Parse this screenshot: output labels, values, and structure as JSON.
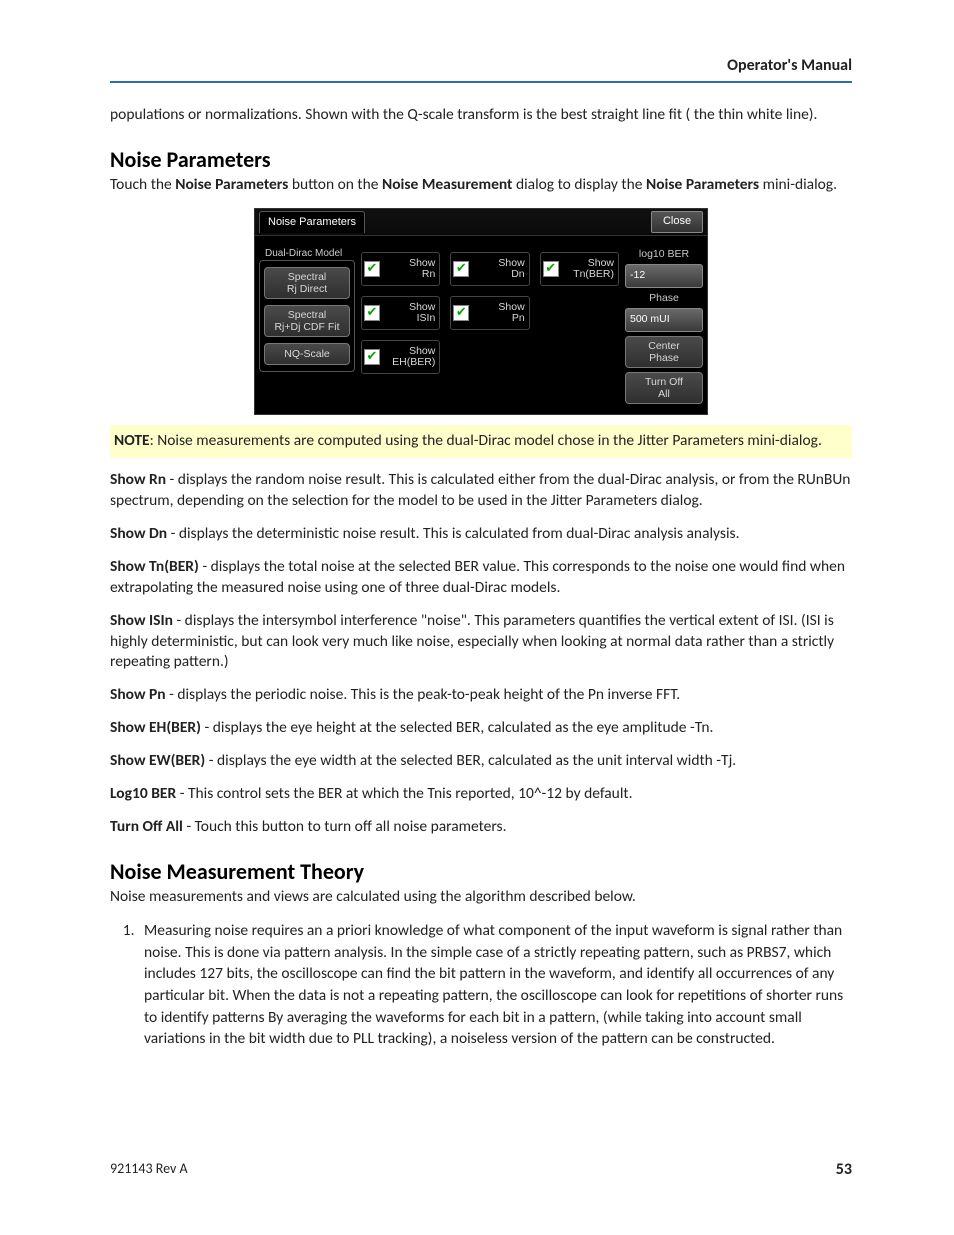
{
  "header": {
    "title": "Operator's Manual"
  },
  "intro": "populations or normalizations. Shown with the Q-scale transform is the best straight line fit ( the thin white line).",
  "section1": {
    "heading": "Noise Parameters",
    "lead_a": "Touch the ",
    "lead_b": "Noise Parameters",
    "lead_c": " button on the ",
    "lead_d": "Noise Measurement",
    "lead_e": " dialog to display the ",
    "lead_f": "Noise Parameters",
    "lead_g": " mini-dialog."
  },
  "dialog": {
    "tab": "Noise Parameters",
    "close": "Close",
    "groupLabel": "Dual-Dirac Model",
    "leftButtons": [
      "Spectral\nRj Direct",
      "Spectral\nRj+Dj CDF Fit",
      "NQ-Scale"
    ],
    "checks": {
      "rn": "Show\nRn",
      "dn": "Show\nDn",
      "tn": "Show\nTn(BER)",
      "isin": "Show\nISIn",
      "pn": "Show\nPn",
      "eh": "Show\nEH(BER)"
    },
    "right": {
      "berLabel": "log10 BER",
      "berVal": "-12",
      "phaseLabel": "Phase",
      "phaseVal": "500 mUI",
      "centerBtn": "Center\nPhase",
      "turnOffBtn": "Turn Off\nAll"
    }
  },
  "note": {
    "label": "NOTE",
    "text": ": Noise measurements are computed using the dual-Dirac model chose in the Jitter Parameters mini-dialog."
  },
  "params": [
    {
      "term": "Show Rn",
      "text": " - displays the random noise result. This is calculated either from the dual-Dirac analysis, or from the RUnBUn spectrum, depending on the selection for the model to be used in the Jitter Parameters dialog."
    },
    {
      "term": "Show Dn",
      "text": " - displays the deterministic noise result. This is calculated from dual-Dirac analysis analysis."
    },
    {
      "term": "Show Tn(BER)",
      "text": " - displays the total noise at the selected BER value. This corresponds to the noise one would find when extrapolating the measured noise using one of three dual-Dirac models."
    },
    {
      "term": "Show ISIn",
      "text": " - displays the intersymbol interference \"noise\". This parameters quantifies the vertical extent of ISI. (ISI is highly deterministic, but can look very much like noise, especially when looking at normal data rather than a strictly repeating pattern.)"
    },
    {
      "term": "Show Pn",
      "text": " - displays the periodic noise. This is the peak-to-peak height of the Pn inverse FFT."
    },
    {
      "term": "Show EH(BER)",
      "text": " - displays the eye height at the selected BER, calculated as the eye amplitude -Tn."
    },
    {
      "term": "Show EW(BER)",
      "text": " - displays the eye width at the selected BER, calculated as the unit interval width -Tj."
    },
    {
      "term": "Log10 BER",
      "text": " - This control sets the BER at which the Tnis reported, 10^-12 by default."
    },
    {
      "term": "Turn Off All",
      "text": " - Touch this button to turn off all noise parameters."
    }
  ],
  "section2": {
    "heading": "Noise Measurement Theory",
    "lead": "Noise measurements and views are calculated using the algorithm described below.",
    "item1": "Measuring noise requires an a priori knowledge of what component of the input waveform is signal rather than noise. This is done via pattern analysis. In the simple case of a strictly repeating pattern, such as PRBS7, which includes 127 bits, the oscilloscope can find the bit pattern in the waveform, and identify all occurrences of any particular bit. When the data is not a repeating pattern, the oscilloscope can look for repetitions of shorter runs to identify patterns By averaging the waveforms for each bit in a pattern, (while taking into account small variations in the bit width due to PLL tracking), a noiseless version of the pattern can be constructed."
  },
  "footer": {
    "rev": "921143 Rev A",
    "page": "53"
  }
}
